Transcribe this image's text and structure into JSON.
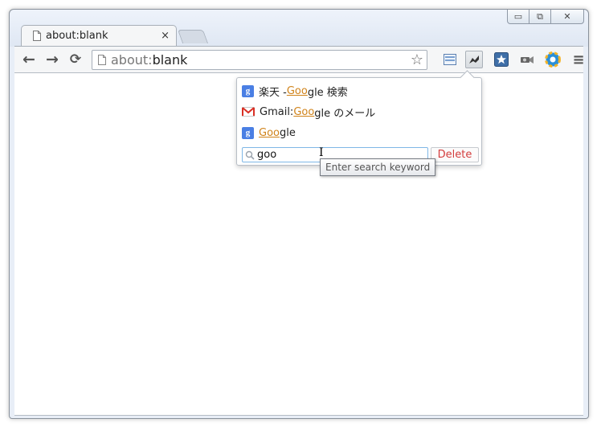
{
  "window": {
    "controls": {
      "minimize": "▭",
      "restore": "⧉",
      "close": "✕"
    }
  },
  "tab": {
    "title": "about:blank",
    "close": "×"
  },
  "toolbar": {
    "back": "←",
    "forward": "→",
    "reload": "⟳"
  },
  "omnibox": {
    "scheme": "about:",
    "rest": "blank",
    "star": "☆"
  },
  "extensions": [
    {
      "icon": "window-list-icon"
    },
    {
      "icon": "search-keyword-extension-icon"
    },
    {
      "icon": "bookmark-star-extension-icon"
    },
    {
      "icon": "camera-extension-icon"
    },
    {
      "icon": "gear-color-extension-icon"
    }
  ],
  "menu": "≡",
  "popup": {
    "items": [
      {
        "icon": "google-icon",
        "icon_text": "g",
        "pre": "楽天 - ",
        "match": "Goo",
        "post": "gle 検索"
      },
      {
        "icon": "gmail-icon",
        "icon_text": "",
        "pre": "Gmail: ",
        "match": "Goo",
        "post": "gle のメール"
      },
      {
        "icon": "google-icon",
        "icon_text": "g",
        "pre": "",
        "match": "Goo",
        "post": "gle"
      }
    ],
    "search_value": "goo",
    "delete_label": "Delete",
    "tooltip": "Enter search keyword"
  },
  "colors": {
    "match": "#d0831a",
    "delete": "#d33c3c",
    "google_blue": "#4a7fe4"
  }
}
